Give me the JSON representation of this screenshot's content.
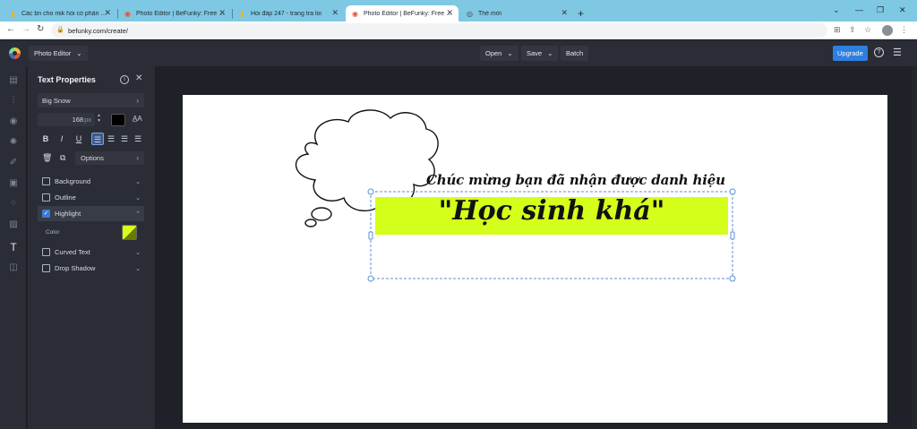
{
  "browser": {
    "tabs": [
      {
        "title": "Các bn cho mik hỏi có phần mềm",
        "active": false
      },
      {
        "title": "Photo Editor | BeFunky: Free Online",
        "active": false
      },
      {
        "title": "Hỏi đáp 247 - trang tra loi",
        "active": false
      },
      {
        "title": "Photo Editor | BeFunky: Free Online",
        "active": true
      },
      {
        "title": "Thẻ mới",
        "active": false
      }
    ],
    "url": "befunky.com/create/"
  },
  "app": {
    "editor_label": "Photo Editor",
    "open_label": "Open",
    "save_label": "Save",
    "batch_label": "Batch",
    "upgrade_label": "Upgrade"
  },
  "panel": {
    "title": "Text Properties",
    "font": "Big Snow",
    "font_size": "168",
    "font_size_unit": "px",
    "options_label": "Options",
    "text_color": "#000000",
    "sections": [
      {
        "label": "Background",
        "checked": false
      },
      {
        "label": "Outline",
        "checked": false
      },
      {
        "label": "Highlight",
        "checked": true
      },
      {
        "label": "Curved Text",
        "checked": false
      },
      {
        "label": "Drop Shadow",
        "checked": false
      }
    ],
    "color_label": "Color",
    "highlight_color": "#d4ff1a"
  },
  "canvas": {
    "line1": "Chúc mừng bạn đã nhận được danh hiệu",
    "line2": "\"Học sinh khá\""
  },
  "colors": {
    "accent": "#2f7fe0",
    "highlight": "#d4ff1a",
    "selection": "#5b8fd8"
  }
}
